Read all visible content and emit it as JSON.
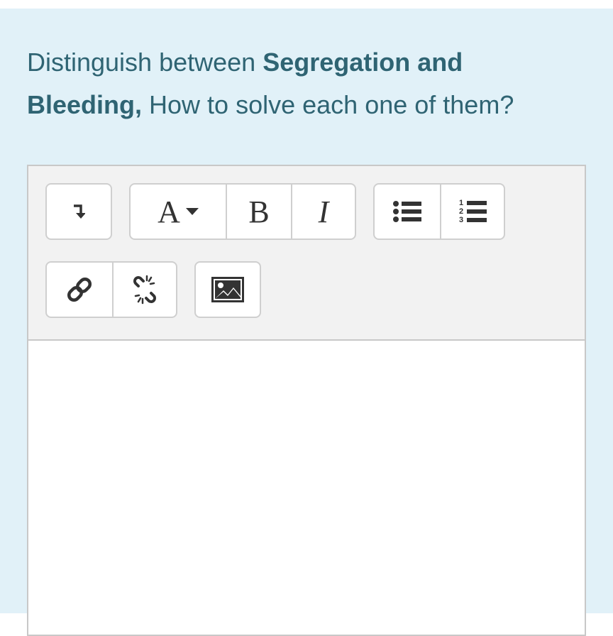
{
  "question": {
    "prefix": "Distinguish between ",
    "bold1": "Segregation and",
    "bold2": "Bleeding,",
    "suffix": " How to solve each one of them?"
  },
  "toolbar": {
    "font_button_label": "A",
    "bold_label": "B",
    "italic_label": "I"
  },
  "editor": {
    "content": ""
  },
  "colors": {
    "panel_bg": "#e1f1f8",
    "question_text": "#2f6473",
    "toolbar_bg": "#f2f2f2",
    "border": "#c8c8c8"
  },
  "icons": [
    "expand-toolbar-icon",
    "font-style-icon",
    "dropdown-caret-icon",
    "bold-icon",
    "italic-icon",
    "unordered-list-icon",
    "ordered-list-icon",
    "link-icon",
    "unlink-icon",
    "image-icon"
  ]
}
